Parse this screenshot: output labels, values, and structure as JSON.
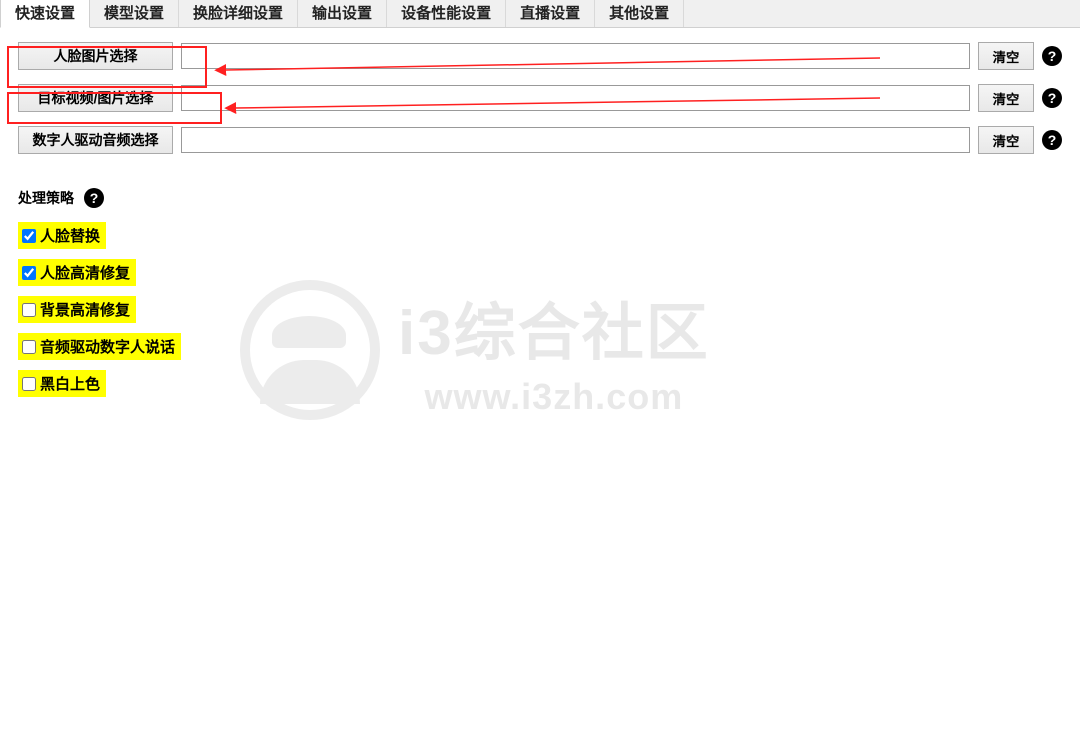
{
  "tabs": [
    {
      "label": "快速设置",
      "active": true
    },
    {
      "label": "模型设置",
      "active": false
    },
    {
      "label": "换脸详细设置",
      "active": false
    },
    {
      "label": "输出设置",
      "active": false
    },
    {
      "label": "设备性能设置",
      "active": false
    },
    {
      "label": "直播设置",
      "active": false
    },
    {
      "label": "其他设置",
      "active": false
    }
  ],
  "fileRows": [
    {
      "key": "face_image",
      "buttonLabel": "人脸图片选择",
      "value": "",
      "clearLabel": "清空"
    },
    {
      "key": "target_media",
      "buttonLabel": "目标视频/图片选择",
      "value": "",
      "clearLabel": "清空"
    },
    {
      "key": "drive_audio",
      "buttonLabel": "数字人驱动音频选择",
      "value": "",
      "clearLabel": "清空"
    }
  ],
  "strategy": {
    "heading": "处理策略",
    "options": [
      {
        "label": "人脸替换",
        "checked": true
      },
      {
        "label": "人脸高清修复",
        "checked": true
      },
      {
        "label": "背景高清修复",
        "checked": false
      },
      {
        "label": "音频驱动数字人说话",
        "checked": false
      },
      {
        "label": "黑白上色",
        "checked": false
      }
    ]
  },
  "watermark": {
    "title": "i3综合社区",
    "url": "www.i3zh.com"
  },
  "helpGlyph": "?"
}
